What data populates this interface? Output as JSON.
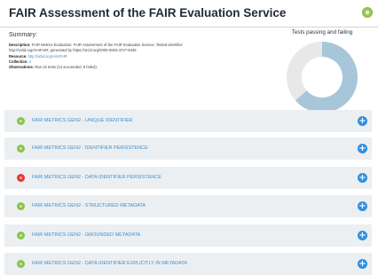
{
  "header": {
    "title": "FAIR Assessment of the FAIR Evaluation Service",
    "status": "pass",
    "status_icon": "check-circle-icon",
    "status_color": "#8bc34a"
  },
  "summary": {
    "label": "Summary:",
    "description_label": "Description:",
    "description_value": "FAIR Metrics Evaluation: FAIR Assessment of the FAIR Evaluation Service; Tested identifier:",
    "description_value_2": "http://w3id.org/AmIFAIR; generated by https://orcid.org/0000-0003-4727-9435",
    "resource_label": "Resource:",
    "resource_value": "http://w3id.org/AmIFAIR",
    "collection_label": "Collection:",
    "collection_value": "4",
    "observations_label": "Observations:",
    "observations_value": "Ran 22 tests (14 succeeded, 8 failed)."
  },
  "chart_data": {
    "type": "pie",
    "title": "Tests passing and failing",
    "categories": [
      "",
      ""
    ],
    "values": [
      14,
      8
    ],
    "colors": [
      "#a7c6d9",
      "#e8e8e8"
    ]
  },
  "metrics": [
    {
      "label": "FAIR METRICS GEN2 - UNIQUE IDENTIFIER",
      "status": "pass"
    },
    {
      "label": "FAIR METRICS GEN2 - IDENTIFIER PERSISTENCE",
      "status": "pass"
    },
    {
      "label": "FAIR METRICS GEN2 - DATA IDENTIFIER PERSISTENCE",
      "status": "fail"
    },
    {
      "label": "FAIR METRICS GEN2 - STRUCTURED METADATA",
      "status": "pass"
    },
    {
      "label": "FAIR METRICS GEN2 - GROUNDED METADATA",
      "status": "pass"
    },
    {
      "label": "FAIR METRICS GEN2 - DATA IDENTIFIER EXPLICITLY IN METADATA",
      "status": "pass"
    }
  ],
  "expand_icon": "plus-circle-icon"
}
